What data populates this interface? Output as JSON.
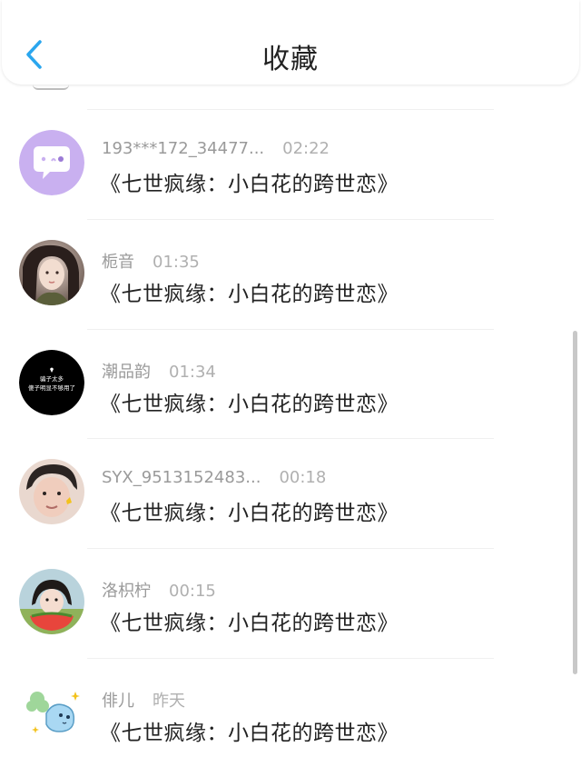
{
  "header": {
    "title": "收藏",
    "back_icon": "chevron-left-icon",
    "accent_color": "#2aa6ee"
  },
  "items": [
    {
      "name": "193***172_34477...",
      "time": "02:22",
      "title": "《七世疯缘：小白花的跨世恋》",
      "avatar": "chat-bubble-avatar"
    },
    {
      "name": "栀音",
      "time": "01:35",
      "title": "《七世疯缘：小白花的跨世恋》",
      "avatar": "photo-avatar"
    },
    {
      "name": "潮品韵",
      "time": "01:34",
      "title": "《七世疯缘：小白花的跨世恋》",
      "avatar": "text-avatar",
      "avatar_text": [
        "骗子太多",
        "傻子明显不够用了"
      ]
    },
    {
      "name": "SYX_9513152483...",
      "time": "00:18",
      "title": "《七世疯缘：小白花的跨世恋》",
      "avatar": "photo-avatar"
    },
    {
      "name": "洛枳柠",
      "time": "00:15",
      "title": "《七世疯缘：小白花的跨世恋》",
      "avatar": "photo-avatar"
    },
    {
      "name": "俳儿",
      "time": "昨天",
      "title": "《七世疯缘：小白花的跨世恋》",
      "avatar": "cartoon-avatar"
    }
  ]
}
